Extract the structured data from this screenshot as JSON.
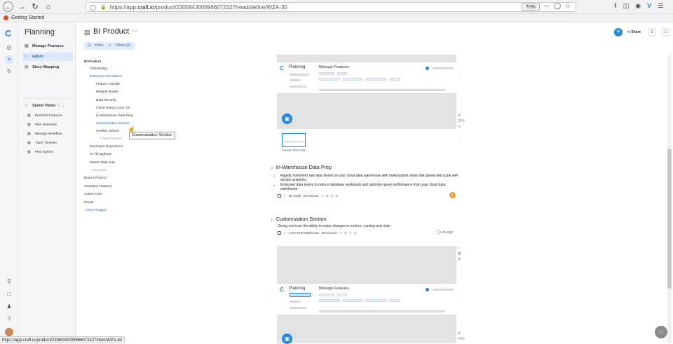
{
  "browser": {
    "url_prefix": "https://app.",
    "url_domain": "craft.io",
    "url_suffix": "/product/2305843009966072327/read/define/WZA-30",
    "zoom": "70%",
    "bookmark_label": "Getting Started",
    "status_url": "https://app.craft.io/product/2305843009966072327/item/WZA-84"
  },
  "sidebar": {
    "title": "Planning",
    "items": [
      {
        "label": "Manage Features",
        "icon": "grid-icon"
      },
      {
        "label": "Editor",
        "icon": "edit-icon"
      },
      {
        "label": "Story Mapping",
        "icon": "map-icon"
      }
    ],
    "saved_views_label": "Saved Views",
    "saved_views": [
      {
        "label": "Prioritize Features"
      },
      {
        "label": "Plan Releases"
      },
      {
        "label": "Manage Workflow"
      },
      {
        "label": "Track Timeline"
      },
      {
        "label": "Plan Sprints"
      }
    ]
  },
  "header": {
    "title": "BI Product",
    "index_label": "Index",
    "filters_label": "Filters (0)",
    "share_label": "Share"
  },
  "tree": {
    "root": "BI Product",
    "nodes": [
      {
        "label": "Onboarding"
      },
      {
        "label": "Enterprise Readiness"
      },
      {
        "label": "Feature Sample"
      },
      {
        "label": "Multiple Nodes"
      },
      {
        "label": "Data Security"
      },
      {
        "label": "Cloud Native Linux OS"
      },
      {
        "label": "In-Warehouse Data Prep"
      },
      {
        "label": "Customization Section"
      },
      {
        "label": "Another feature"
      },
      {
        "label": "+ New Feature"
      },
      {
        "label": "Developer Experience"
      },
      {
        "label": "AI Throughout"
      },
      {
        "label": "Elastic Data Hub"
      },
      {
        "label": "+ New Epic"
      },
      {
        "label": "Brian's Product"
      },
      {
        "label": "Unsorted Features"
      },
      {
        "label": "Autum Core"
      },
      {
        "label": "Paolar"
      },
      {
        "label": "+ New Product"
      }
    ],
    "tooltip": "Customization Section"
  },
  "content": {
    "mini_planning": "Planning",
    "mini_manage": "Manage Features",
    "thumb_label": "Screen Shot 202...",
    "zoom_pct": "20%",
    "section1": {
      "title": "In-Warehouse Data Prep",
      "bullets": [
        "Rapidly transform raw data stored on your cloud data warehouse with materialized views that speed and scale self-service analytics.",
        "Empower data teams to reduce database workloads and optimize query performance from your cloud data warehouse."
      ],
      "meta": [
        "Q4 2020",
        "BACKLOG",
        "0",
        "1"
      ],
      "avatar": "BI"
    },
    "section2": {
      "title": "Customization Section",
      "description": "Giving end user the ability to make changes in metrics, naming and units",
      "meta": [
        "CATCHUP RELEASE",
        "BACKLOG",
        "0",
        "2"
      ],
      "assign_label": "Assign"
    }
  }
}
